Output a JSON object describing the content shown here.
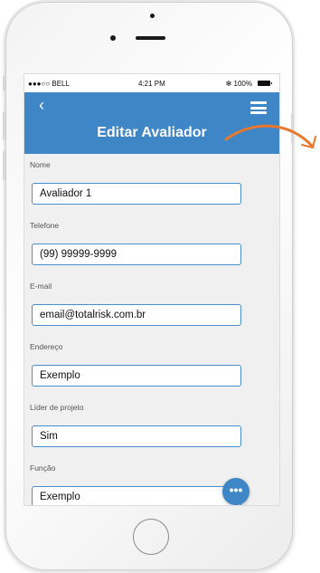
{
  "status": {
    "carrier": "●●●○○ BELL ",
    "time": "4:21 PM",
    "battery": "✻ 100%"
  },
  "header": {
    "back_icon": "chevron-left-icon",
    "title": "Editar Avaliador",
    "menu_icon": "hamburger-menu-icon"
  },
  "form": {
    "fields": [
      {
        "label": "Nome",
        "value": "Avaliador 1"
      },
      {
        "label": "Telefone",
        "value": "(99) 99999-9999"
      },
      {
        "label": "E-mail",
        "value": "email@totalrisk.com.br"
      },
      {
        "label": "Endereço",
        "value": "Exemplo"
      },
      {
        "label": "Líder de projeto",
        "value": "Sim"
      },
      {
        "label": "Função",
        "value": "Exemplo"
      }
    ]
  },
  "fab": {
    "label": "•••",
    "icon": "more-icon"
  },
  "colors": {
    "accent": "#3f86c6",
    "arrow": "#e8782f",
    "input_border": "#4a8ed0"
  }
}
